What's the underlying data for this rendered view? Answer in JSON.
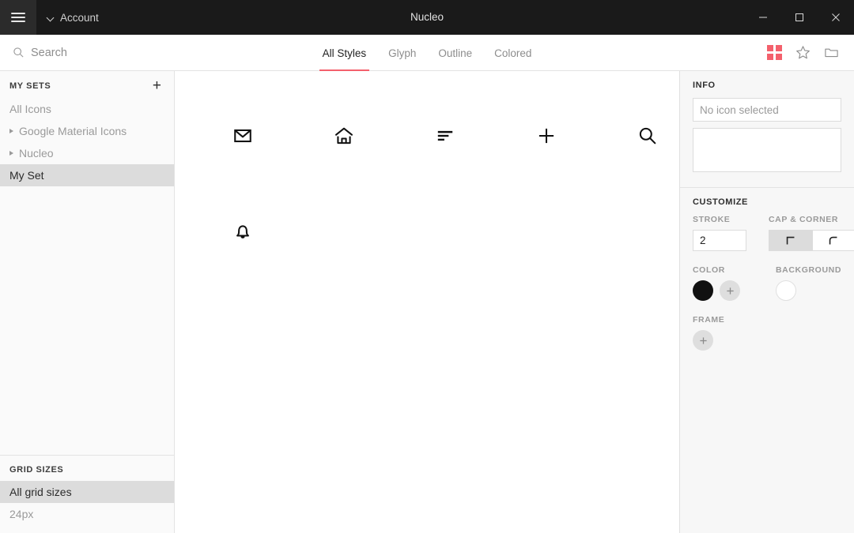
{
  "titlebar": {
    "menu_icon": "hamburger-icon",
    "account_label": "Account",
    "window_title": "Nucleo",
    "minimize_label": "Minimize",
    "maximize_label": "Maximize",
    "close_label": "Close"
  },
  "toolbar": {
    "search_placeholder": "Search",
    "search_value": "",
    "tabs": [
      {
        "label": "All Styles",
        "active": true
      },
      {
        "label": "Glyph",
        "active": false
      },
      {
        "label": "Outline",
        "active": false
      },
      {
        "label": "Colored",
        "active": false
      }
    ],
    "icons": [
      {
        "name": "grid-view-icon",
        "active": true
      },
      {
        "name": "star-icon",
        "active": false
      },
      {
        "name": "folder-icon",
        "active": false
      }
    ],
    "accent_color": "#f4606c"
  },
  "sidebar": {
    "my_sets_label": "MY SETS",
    "add_set_label": "+",
    "sets": [
      {
        "label": "All Icons",
        "expandable": false,
        "selected": false
      },
      {
        "label": "Google Material Icons",
        "expandable": true,
        "selected": false
      },
      {
        "label": "Nucleo",
        "expandable": true,
        "selected": false
      },
      {
        "label": "My Set",
        "expandable": false,
        "selected": true
      }
    ],
    "grid_sizes_label": "GRID SIZES",
    "grid_sizes": [
      {
        "label": "All grid sizes",
        "selected": true
      },
      {
        "label": "24px",
        "selected": false
      }
    ]
  },
  "icon_grid": {
    "icons": [
      {
        "name": "mail-icon",
        "label": "mail"
      },
      {
        "name": "home-icon",
        "label": "home"
      },
      {
        "name": "align-left-icon",
        "label": "align left"
      },
      {
        "name": "plus-icon",
        "label": "plus"
      },
      {
        "name": "search-icon",
        "label": "search"
      },
      {
        "name": "bell-icon",
        "label": "bell"
      }
    ]
  },
  "info_panel": {
    "title": "INFO",
    "name_placeholder": "No icon selected",
    "name_value": "",
    "tags_value": "",
    "tags_placeholder": ""
  },
  "customize_panel": {
    "title": "CUSTOMIZE",
    "stroke_label": "STROKE",
    "stroke_value": "2",
    "cap_corner_label": "CAP & CORNER",
    "cap_options": [
      {
        "name": "sharp-corner-icon",
        "active": true
      },
      {
        "name": "rounded-corner-icon",
        "active": false
      }
    ],
    "color_label": "COLOR",
    "color_value": "#111111",
    "add_color_label": "+",
    "background_label": "BACKGROUND",
    "background_value": "#ffffff",
    "frame_label": "FRAME",
    "add_frame_label": "+"
  }
}
